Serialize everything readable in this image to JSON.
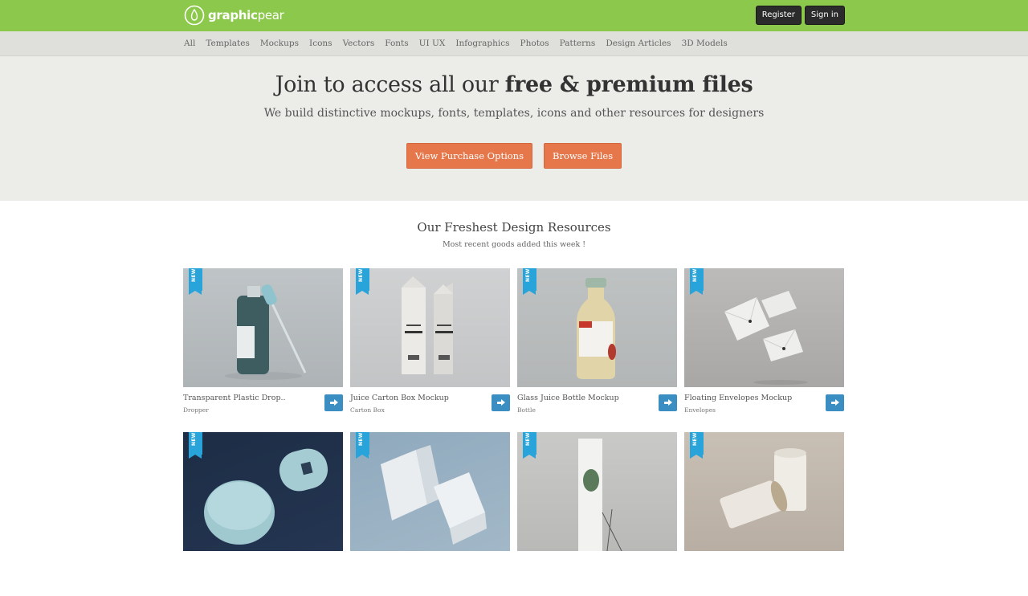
{
  "brand": {
    "name_bold": "graphic",
    "name_light": "pear"
  },
  "auth": {
    "register": "Register",
    "signin": "Sign in"
  },
  "categories": [
    "All",
    "Templates",
    "Mockups",
    "Icons",
    "Vectors",
    "Fonts",
    "UI UX",
    "Infographics",
    "Photos",
    "Patterns",
    "Design Articles",
    "3D Models"
  ],
  "hero": {
    "title_light": "Join to access all our ",
    "title_bold": "free & premium files",
    "subtitle": "We build distinctive mockups, fonts, templates, icons and other resources for designers",
    "primary_button": "View Purchase Options",
    "secondary_button": "Browse Files"
  },
  "section": {
    "title": "Our Freshest Design Resources",
    "subtitle": "Most recent goods added this week !"
  },
  "badge_label": "NEW",
  "products": [
    {
      "title": "Transparent Plastic Drop..",
      "category": "Dropper"
    },
    {
      "title": "Juice Carton Box Mockup",
      "category": "Carton Box"
    },
    {
      "title": "Glass Juice Bottle Mockup",
      "category": "Bottle"
    },
    {
      "title": "Floating Envelopes Mockup",
      "category": "Envelopes"
    },
    {
      "title": "",
      "category": ""
    },
    {
      "title": "",
      "category": ""
    },
    {
      "title": "",
      "category": ""
    },
    {
      "title": "",
      "category": ""
    }
  ],
  "colors": {
    "topbar": "#8cc84b",
    "accent_orange": "#e5774a",
    "badge_blue": "#28a4db",
    "go_button": "#3b8ec2"
  }
}
